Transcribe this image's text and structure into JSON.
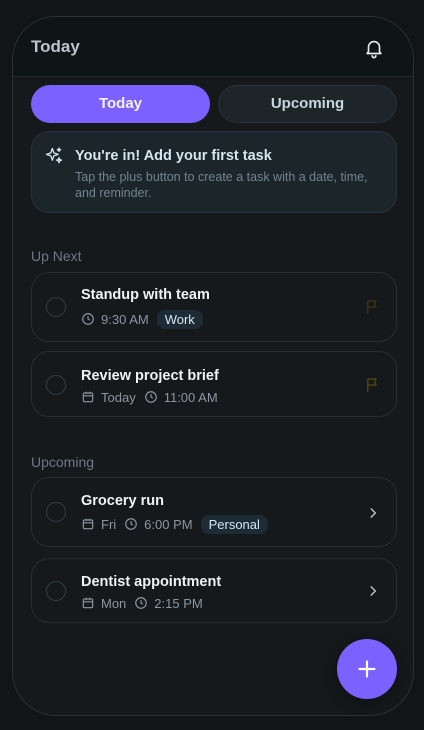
{
  "header": {
    "title": "Today",
    "notifications_icon": "bell-icon"
  },
  "tabs": [
    {
      "label": "Today",
      "active": true
    },
    {
      "label": "Upcoming",
      "active": false
    }
  ],
  "banner": {
    "icon": "sparkles-icon",
    "title": "You're in! Add your first task",
    "body": "Tap the plus button to create a task with a date, time, and reminder."
  },
  "sections": {
    "up_next": {
      "label": "Up Next",
      "tasks": [
        {
          "title": "Standup with team",
          "time": "9:30 AM",
          "tag": "Work",
          "flag_color": "#3a3413"
        },
        {
          "title": "Review project brief",
          "date": "Today",
          "time": "11:00 AM",
          "flag_color": "#4c4312"
        }
      ]
    },
    "upcoming": {
      "label": "Upcoming",
      "tasks": [
        {
          "title": "Grocery run",
          "date": "Fri",
          "time": "6:00 PM",
          "tag": "Personal"
        },
        {
          "title": "Dentist appointment",
          "date": "Mon",
          "time": "2:15 PM"
        }
      ]
    }
  },
  "colors": {
    "accent": "#7b61ff",
    "background": "#15191c"
  },
  "fab": {
    "icon": "plus-icon"
  }
}
